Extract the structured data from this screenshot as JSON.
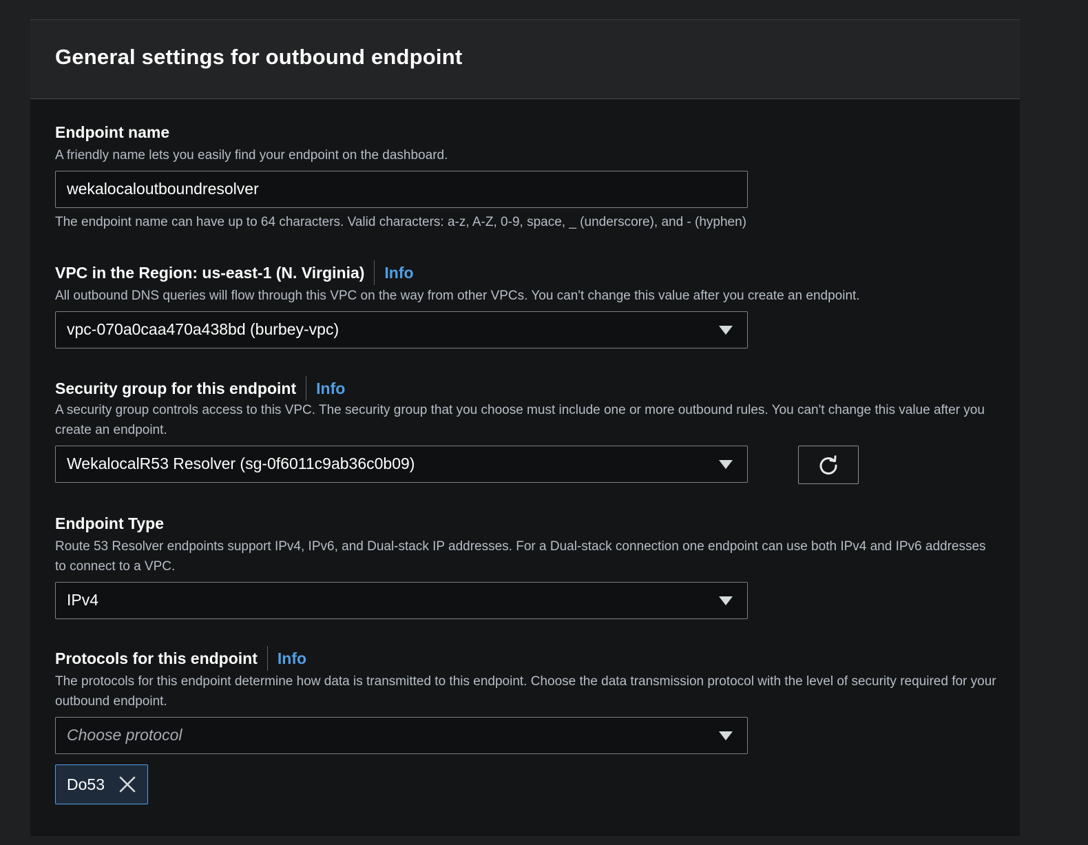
{
  "panel": {
    "title": "General settings for outbound endpoint"
  },
  "endpoint_name": {
    "label": "Endpoint name",
    "description": "A friendly name lets you easily find your endpoint on the dashboard.",
    "value": "wekalocaloutboundresolver",
    "constraint": "The endpoint name can have up to 64 characters. Valid characters: a-z, A-Z, 0-9, space, _ (underscore), and - (hyphen)"
  },
  "vpc": {
    "label": "VPC in the Region: us-east-1 (N. Virginia)",
    "info": "Info",
    "description": "All outbound DNS queries will flow through this VPC on the way from other VPCs. You can't change this value after you create an endpoint.",
    "selected": "vpc-070a0caa470a438bd (burbey-vpc)"
  },
  "security_group": {
    "label": "Security group for this endpoint",
    "info": "Info",
    "description": "A security group controls access to this VPC. The security group that you choose must include one or more outbound rules. You can't change this value after you create an endpoint.",
    "selected": "WekalocalR53 Resolver (sg-0f6011c9ab36c0b09)",
    "refresh_icon": "refresh-icon"
  },
  "endpoint_type": {
    "label": "Endpoint Type",
    "description": "Route 53 Resolver endpoints support IPv4, IPv6, and Dual-stack IP addresses. For a Dual-stack connection one endpoint can use both IPv4 and IPv6 addresses to connect to a VPC.",
    "selected": "IPv4"
  },
  "protocols": {
    "label": "Protocols for this endpoint",
    "info": "Info",
    "description": "The protocols for this endpoint determine how data is transmitted to this endpoint. Choose the data transmission protocol with the level of security required for your outbound endpoint.",
    "placeholder": "Choose protocol",
    "tokens": [
      {
        "label": "Do53"
      }
    ]
  },
  "colors": {
    "background": "#1f2022",
    "panel": "#141516",
    "header": "#232425",
    "link": "#539fe5",
    "border": "#7d8289",
    "token_border": "#539fe5"
  }
}
